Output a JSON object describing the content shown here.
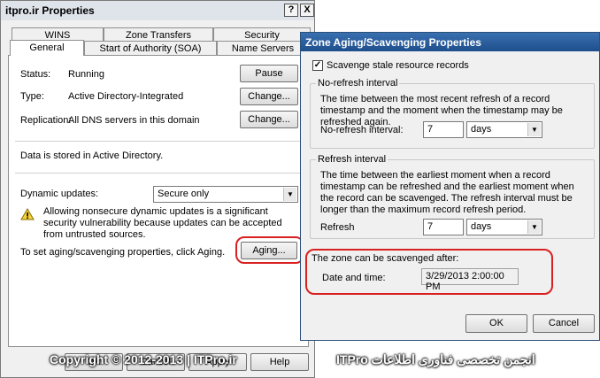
{
  "props": {
    "title": "itpro.ir Properties",
    "help_glyph": "?",
    "close_glyph": "X",
    "tabs_top": [
      "WINS",
      "Zone Transfers",
      "Security"
    ],
    "tabs_bottom": [
      "General",
      "Start of Authority (SOA)",
      "Name Servers"
    ],
    "status_label": "Status:",
    "status_value": "Running",
    "pause_label": "Pause",
    "type_label": "Type:",
    "type_value": "Active Directory-Integrated",
    "change_label": "Change...",
    "replication_label": "Replication:",
    "replication_value": "All DNS servers in this domain",
    "stored_text": "Data is stored in Active Directory.",
    "dynamic_label": "Dynamic updates:",
    "dynamic_value": "Secure only",
    "warning_text": "Allowing nonsecure dynamic updates is a significant security vulnerability because updates can be accepted from untrusted sources.",
    "aging_text": "To set aging/scavenging properties, click Aging.",
    "aging_button": "Aging...",
    "ok_label": "OK",
    "cancel_label": "Cancel",
    "apply_label": "Apply",
    "help_label": "Help"
  },
  "aging": {
    "title": "Zone Aging/Scavenging Properties",
    "scavenge_label": "Scavenge stale resource records",
    "scavenge_checked": true,
    "norefresh_title": "No-refresh interval",
    "norefresh_desc": "The time between the most recent refresh of a record timestamp and the moment when the timestamp may be refreshed again.",
    "norefresh_label": "No-refresh interval:",
    "norefresh_value": "7",
    "norefresh_unit": "days",
    "refresh_title": "Refresh interval",
    "refresh_desc": "The time between the earliest moment when a record timestamp can be refreshed and the earliest moment when the record can be scavenged. The refresh interval must be longer than the maximum record refresh period.",
    "refresh_label": "Refresh",
    "refresh_value": "7",
    "refresh_unit": "days",
    "scavenge_after": "The zone can be scavenged after:",
    "datetime_label": "Date and time:",
    "datetime_value": "3/29/2013 2:00:00 PM",
    "ok_label": "OK",
    "cancel_label": "Cancel"
  },
  "watermark": {
    "left": "Copyright © 2012-2013 | ITPro.ir",
    "right": "انجمن تخصصی فناوری اطلاعات ITPro"
  },
  "colors": {
    "highlight_red": "#d92020",
    "active_title": "#1e4f8c",
    "window_bg": "#f0f0f0"
  },
  "icons": {
    "warning": "warning-icon",
    "combo_arrow": "chevron-down-icon",
    "checkbox": "checkbox-icon"
  }
}
